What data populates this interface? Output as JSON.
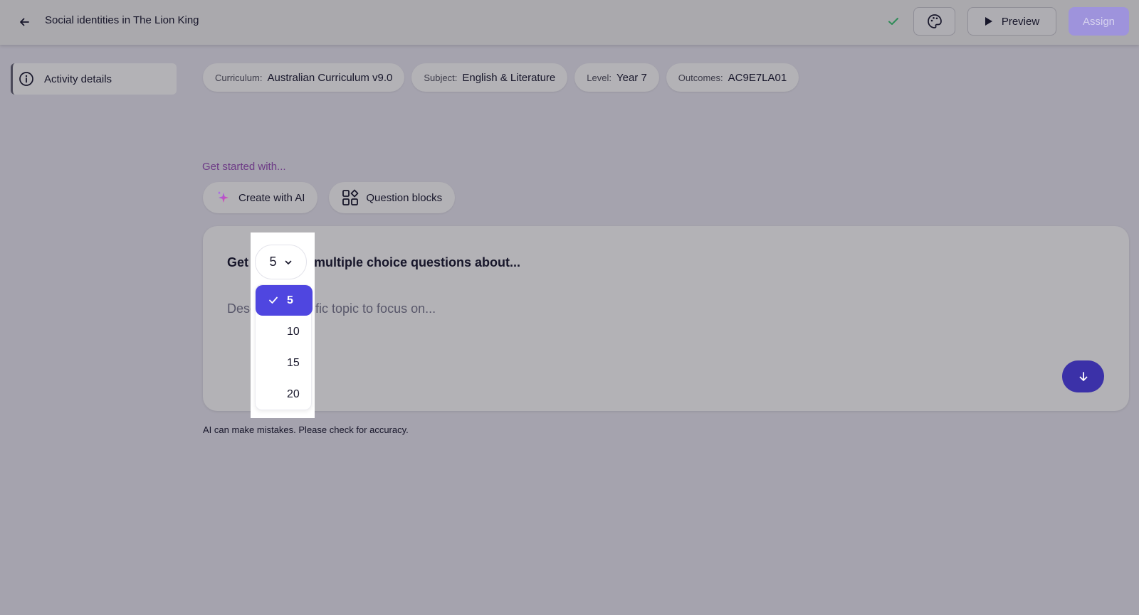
{
  "header": {
    "title": "Social identities in The Lion King",
    "back_icon": "arrow-left-icon",
    "saved_icon": "check-icon",
    "palette_icon": "palette-icon",
    "preview_label": "Preview",
    "assign_label": "Assign",
    "colors": {
      "assign_bg": "#9e93dc",
      "saved_check": "#2e8b57"
    }
  },
  "sidebar": {
    "items": [
      {
        "label": "Activity details",
        "icon": "info-icon"
      }
    ]
  },
  "chips": [
    {
      "key": "Curriculum:",
      "value": "Australian Curriculum v9.0"
    },
    {
      "key": "Subject:",
      "value": "English & Literature"
    },
    {
      "key": "Level:",
      "value": "Year 7"
    },
    {
      "key": "Outcomes:",
      "value": "AC9E7LA01"
    }
  ],
  "get_started": {
    "heading": "Get started with...",
    "create_ai_label": "Create with AI",
    "question_blocks_label": "Question blocks"
  },
  "prompt": {
    "prefix": "Get",
    "suffix": "multiple choice questions about...",
    "placeholder_visible": "Desc",
    "placeholder_visible_tail": "cific topic to focus on...",
    "submit_icon": "arrow-down-icon"
  },
  "count_dropdown": {
    "selected": "5",
    "options": [
      "5",
      "10",
      "15",
      "20"
    ],
    "selected_color": "#4f46e0"
  },
  "disclaimer": "AI can make mistakes. Please check for accuracy."
}
